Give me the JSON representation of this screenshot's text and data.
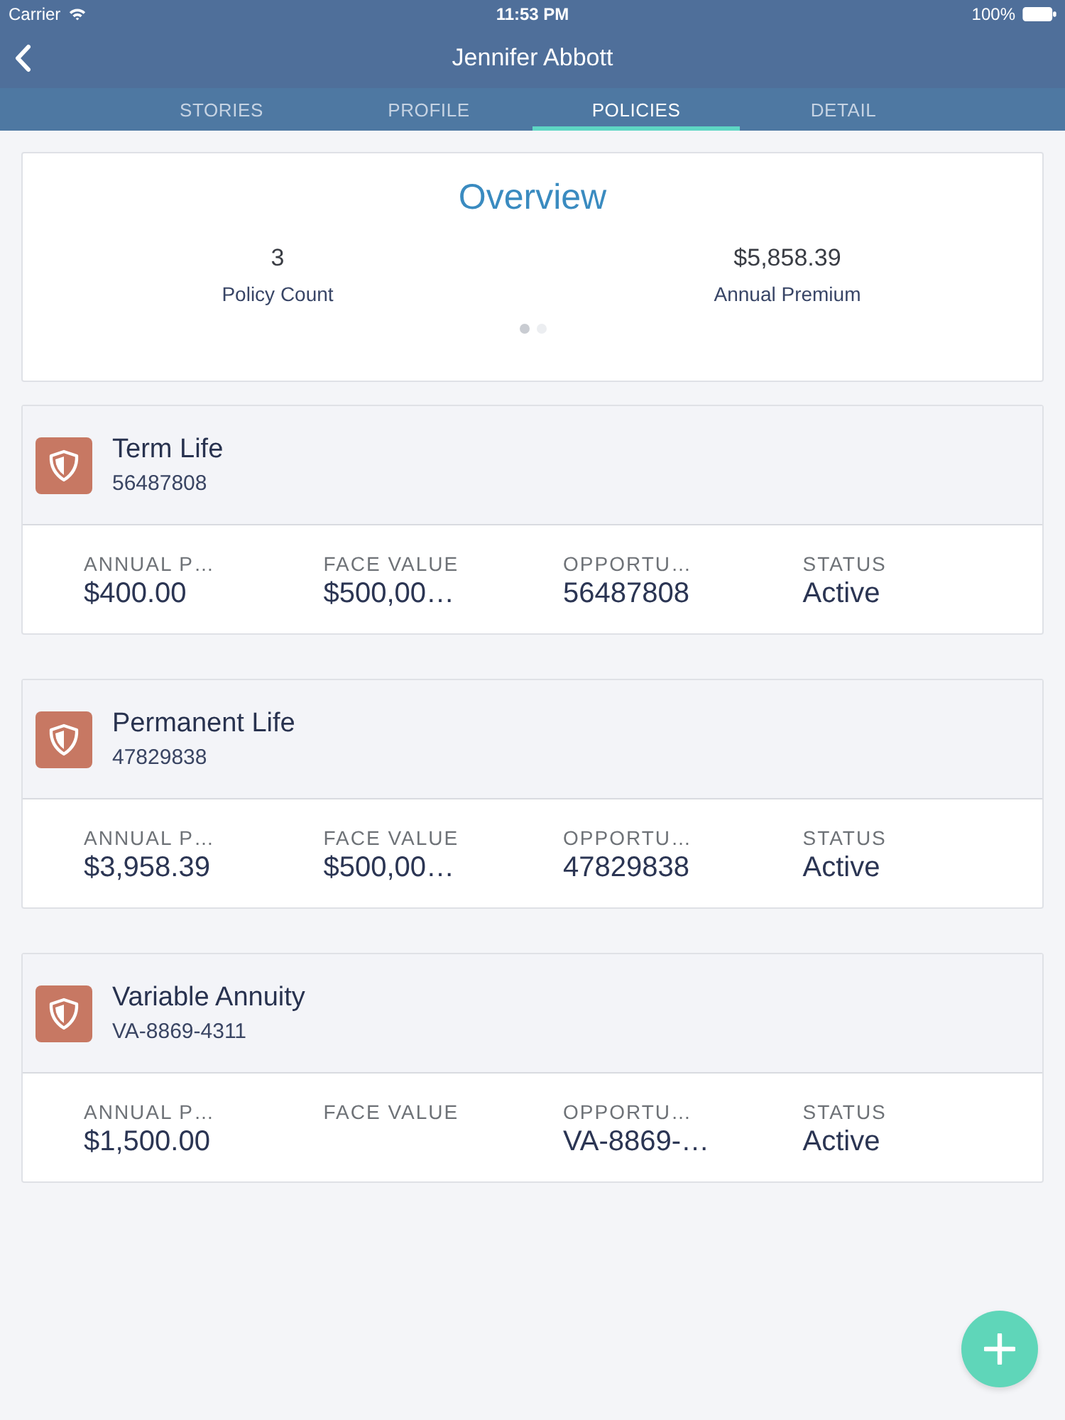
{
  "status_bar": {
    "carrier": "Carrier",
    "time": "11:53 PM",
    "battery": "100%"
  },
  "nav": {
    "title": "Jennifer Abbott"
  },
  "tabs": [
    {
      "label": "STORIES",
      "selected": false
    },
    {
      "label": "PROFILE",
      "selected": false
    },
    {
      "label": "POLICIES",
      "selected": true
    },
    {
      "label": "DETAIL",
      "selected": false
    }
  ],
  "overview": {
    "title": "Overview",
    "stats": [
      {
        "value": "3",
        "label": "Policy Count"
      },
      {
        "value": "$5,858.39",
        "label": "Annual Premium"
      }
    ],
    "pages": [
      {
        "selected": true
      },
      {
        "selected": false
      }
    ]
  },
  "policies": [
    {
      "name": "Term Life",
      "number": "56487808",
      "fields": [
        {
          "label": "ANNUAL P…",
          "value": "$400.00"
        },
        {
          "label": "FACE VALUE",
          "value": "$500,00…"
        },
        {
          "label": "OPPORTU…",
          "value": "56487808"
        },
        {
          "label": "STATUS",
          "value": "Active"
        }
      ]
    },
    {
      "name": "Permanent Life",
      "number": "47829838",
      "fields": [
        {
          "label": "ANNUAL P…",
          "value": "$3,958.39"
        },
        {
          "label": "FACE VALUE",
          "value": "$500,00…"
        },
        {
          "label": "OPPORTU…",
          "value": "47829838"
        },
        {
          "label": "STATUS",
          "value": "Active"
        }
      ]
    },
    {
      "name": "Variable Annuity",
      "number": "VA-8869-4311",
      "fields": [
        {
          "label": "ANNUAL P…",
          "value": "$1,500.00"
        },
        {
          "label": "FACE VALUE"
        },
        {
          "label": "OPPORTU…",
          "value": "VA-8869-…"
        },
        {
          "label": "STATUS",
          "value": "Active"
        }
      ]
    }
  ]
}
